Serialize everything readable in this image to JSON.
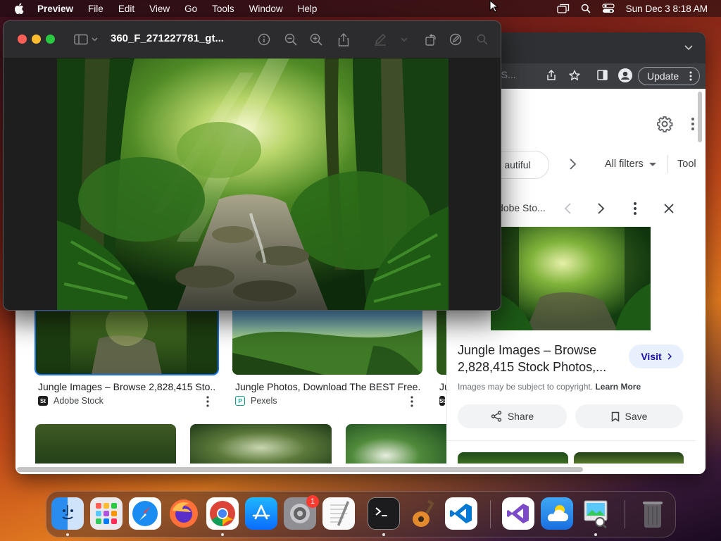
{
  "menubar": {
    "app_name": "Preview",
    "items": [
      "File",
      "Edit",
      "View",
      "Go",
      "Tools",
      "Window",
      "Help"
    ],
    "clock": "Sun Dec 3  8:18 AM",
    "icons": [
      "screen-mirroring-icon",
      "spotlight-search-icon",
      "control-center-icon"
    ]
  },
  "preview": {
    "title": "360_F_271227781_gt...",
    "toolbar_icons": [
      "sidebar-icon",
      "info-icon",
      "zoom-out-icon",
      "zoom-in-icon",
      "share-icon",
      "markup-pen-icon",
      "rotate-icon",
      "markup-icon",
      "search-icon"
    ]
  },
  "chrome": {
    "omnibox_text": "_–NS...",
    "update_label": "Update",
    "filters": {
      "chip_beautiful": "autiful",
      "all_filters": "All filters",
      "tools": "Tool"
    },
    "panel": {
      "source": "dobe Sto...",
      "title": "Jungle Images – Browse 2,828,415 Stock Photos,...",
      "visit": "Visit",
      "copyright": "Images may be subject to copyright.",
      "learn_more": "Learn More",
      "share": "Share",
      "save": "Save"
    },
    "results": [
      {
        "title": "Jungle Images – Browse 2,828,415 Sto...",
        "source": "Adobe Stock",
        "favicon": "St"
      },
      {
        "title": "Jungle Photos, Download The BEST Free...",
        "source": "Pexels",
        "favicon": "P"
      },
      {
        "title": "Ju",
        "source": "",
        "favicon": "St"
      }
    ]
  },
  "dock": {
    "apps": [
      "Finder",
      "Launchpad",
      "Safari",
      "Firefox",
      "Chrome",
      "App Store",
      "System Settings",
      "TextEdit",
      "Terminal",
      "GarageBand",
      "VS Code",
      "Visual Studio",
      "Weather",
      "Preview",
      "Trash"
    ],
    "settings_badge": "1"
  },
  "colors": {
    "accent": "#1a73e8",
    "close": "#ff5f57",
    "minimize": "#febc2e",
    "zoom": "#28c840"
  }
}
